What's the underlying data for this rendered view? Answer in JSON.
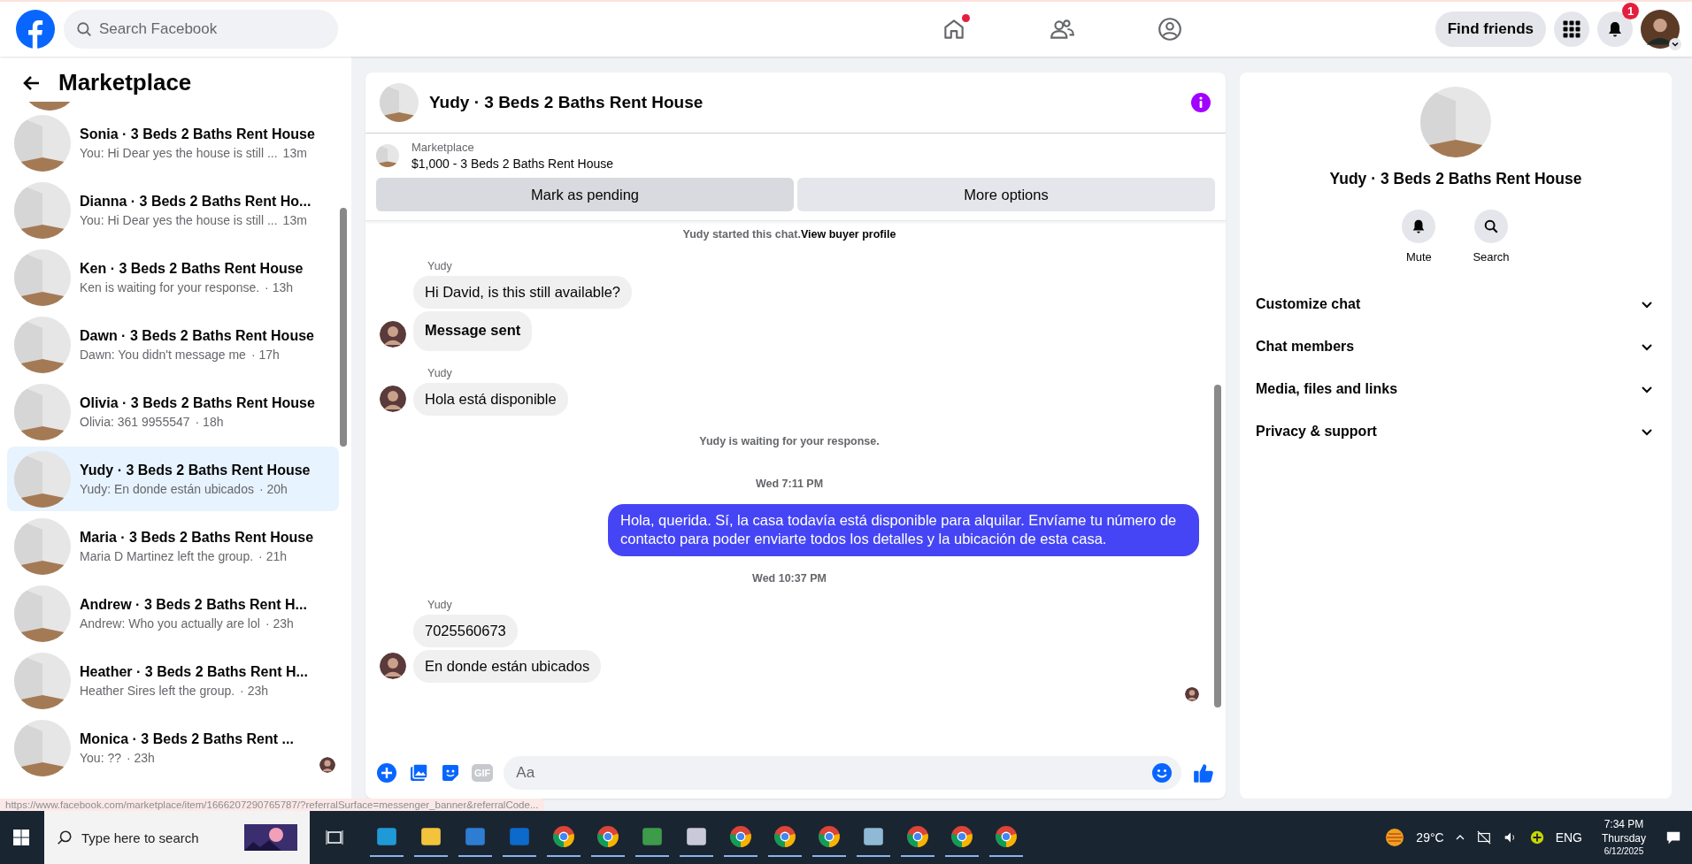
{
  "top_bar": {
    "search": {
      "placeholder": "Search Facebook"
    },
    "nav": [
      {
        "kind": "home",
        "notification_dot": true
      },
      {
        "kind": "friends",
        "notification_dot": false
      },
      {
        "kind": "groups",
        "notification_dot": false
      }
    ],
    "find_friends": "Find friends",
    "notification_count": "1"
  },
  "sidebar": {
    "title": "Marketplace",
    "conversations": [
      {
        "name": "Sonia · 3 Beds 2 Baths Rent House",
        "preview": "You: Hi Dear yes the house is still ...",
        "time": "13m",
        "selected": false,
        "seen": false
      },
      {
        "name": "Dianna · 3 Beds 2 Baths Rent Ho...",
        "preview": "You: Hi Dear yes the house is still ...",
        "time": "13m",
        "selected": false,
        "seen": false
      },
      {
        "name": "Ken · 3 Beds 2 Baths Rent House",
        "preview": "Ken is waiting for your response.",
        "time": "· 13h",
        "selected": false,
        "seen": false
      },
      {
        "name": "Dawn · 3 Beds 2 Baths Rent House",
        "preview": "Dawn: You didn't message me",
        "time": "· 17h",
        "selected": false,
        "seen": false
      },
      {
        "name": "Olivia · 3 Beds 2 Baths Rent House",
        "preview": "Olivia: 361 9955547",
        "time": "· 18h",
        "selected": false,
        "seen": false
      },
      {
        "name": "Yudy · 3 Beds 2 Baths Rent House",
        "preview": "Yudy: En donde están ubicados",
        "time": "· 20h",
        "selected": true,
        "seen": false
      },
      {
        "name": "Maria · 3 Beds 2 Baths Rent House",
        "preview": "Maria D Martinez left the group.",
        "time": "· 21h",
        "selected": false,
        "seen": false
      },
      {
        "name": "Andrew · 3 Beds 2 Baths Rent H...",
        "preview": "Andrew: Who you actually are lol",
        "time": "· 23h",
        "selected": false,
        "seen": false
      },
      {
        "name": "Heather · 3 Beds 2 Baths Rent H...",
        "preview": "Heather Sires left the group.",
        "time": "· 23h",
        "selected": false,
        "seen": false
      },
      {
        "name": "Monica · 3 Beds 2 Baths Rent ...",
        "preview": "You: ??",
        "time": "· 23h",
        "selected": false,
        "seen": true
      }
    ]
  },
  "chat": {
    "title": "Yudy · 3 Beds 2 Baths Rent House",
    "listing": {
      "source": "Marketplace",
      "title": "$1,000 - 3 Beds 2 Baths Rent House"
    },
    "buttons": [
      "Mark as pending",
      "More options"
    ],
    "messages": [
      {
        "kind": "notice",
        "text": "Yudy started this chat.",
        "link": "View buyer profile"
      },
      {
        "kind": "sender",
        "text": "Yudy"
      },
      {
        "kind": "incoming",
        "text": "Hi David, is this still available?",
        "bold": false,
        "avatar": false
      },
      {
        "kind": "incoming",
        "text": "Message sent",
        "bold": true,
        "avatar": true
      },
      {
        "kind": "sender",
        "text": "Yudy"
      },
      {
        "kind": "incoming",
        "text": "Hola está disponible",
        "bold": false,
        "avatar": true
      },
      {
        "kind": "notice",
        "text": "Yudy is waiting for your response."
      },
      {
        "kind": "time",
        "text": "Wed 7:11 PM"
      },
      {
        "kind": "outgoing",
        "text": "Hola, querida. Sí, la casa todavía está disponible para alquilar. Envíame tu número de contacto para poder enviarte todos los detalles y la ubicación de esta casa."
      },
      {
        "kind": "time",
        "text": "Wed 10:37 PM"
      },
      {
        "kind": "sender",
        "text": "Yudy"
      },
      {
        "kind": "incoming",
        "text": "7025560673",
        "bold": false,
        "avatar": false
      },
      {
        "kind": "incoming",
        "text": "En donde están ubicados",
        "bold": false,
        "avatar": true
      }
    ],
    "composer": {
      "placeholder": "Aa",
      "gif_label": "GIF"
    }
  },
  "details": {
    "title": "Yudy · 3 Beds 2 Baths Rent House",
    "actions": [
      {
        "kind": "mute",
        "label": "Mute"
      },
      {
        "kind": "search",
        "label": "Search"
      }
    ],
    "sections": [
      {
        "label": "Customize chat",
        "expanded": false
      },
      {
        "label": "Chat members",
        "expanded": false
      },
      {
        "label": "Media, files and links",
        "expanded": false
      },
      {
        "label": "Privacy & support",
        "expanded": false
      }
    ]
  },
  "status_url": "https://www.facebook.com/marketplace/item/1666207290765787/?referralSurface=messenger_banner&referralCode...",
  "taskbar": {
    "search_placeholder": "Type here to search",
    "weather": "29°C",
    "language": "ENG",
    "time": "7:34 PM",
    "day": "Thursday",
    "date": "6/12/2025"
  }
}
